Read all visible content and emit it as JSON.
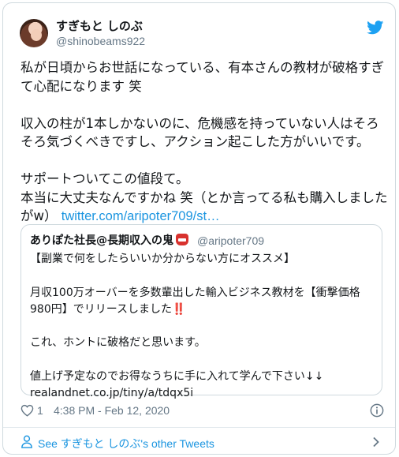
{
  "author": {
    "display_name": "すぎもと しのぶ",
    "handle": "@shinobeams922"
  },
  "tweet": {
    "paragraphs": [
      "私が日頃からお世話になっている、有本さんの教材が破格すぎて心配になります 笑",
      "収入の柱が1本しかないのに、危機感を持っていない人はそろそろ気づくべきですし、アクション起こした方がいいです。"
    ],
    "last_paragraph": "サポートついてこの値段て。\n本当に大丈夫なんですかね 笑（とか言ってる私も購入しましたがw）",
    "link": "twitter.com/aripoter709/st…"
  },
  "quoted": {
    "name": "ありぽた社長@長期収入の鬼",
    "handle": "@aripoter709",
    "line1": "【副業で何をしたらいいか分からない方にオススメ】",
    "para2": "月収100万オーバーを多数輩出した輸入ビジネス教材を【衝撃価格980円】でリリースしました",
    "bang": "‼️",
    "para3": "これ、ホントに破格だと思います。",
    "para4": "値上げ予定なのでお得なうちに手に入れて学んで下さい↓↓",
    "url": "realandnet.co.jp/tiny/a/tdqx5i"
  },
  "footer": {
    "like_count": "1",
    "timestamp": "4:38 PM - Feb 12, 2020",
    "see_more": "See すぎもと しのぶ's other Tweets"
  },
  "colors": {
    "link_blue": "#1b95e0",
    "text": "#14171a",
    "muted": "#657786",
    "border": "#cfd9de"
  },
  "icons": {
    "brand": "twitter-bird-icon",
    "like": "heart-icon",
    "info": "info-icon",
    "person": "person-icon",
    "chevron": "chevron-right-icon",
    "emoji": "oni-mask-icon"
  }
}
